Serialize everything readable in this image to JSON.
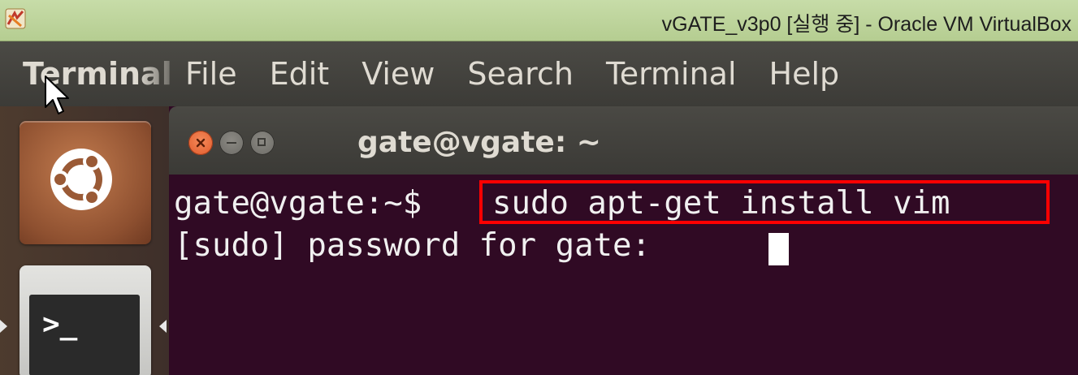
{
  "vbox": {
    "window_title": "vGATE_v3p0 [실행 중] - Oracle VM VirtualBox"
  },
  "menubar": {
    "app_name": "Terminal",
    "items": [
      "File",
      "Edit",
      "View",
      "Search",
      "Terminal",
      "Help"
    ]
  },
  "terminal": {
    "title": "gate@vgate: ~",
    "prompt": "gate@vgate:~$",
    "command": "sudo apt-get install vim",
    "password_prompt": "[sudo] password for gate: ",
    "background_color": "#300a24",
    "highlight_color": "#ff0000"
  },
  "launcher": {
    "icons": [
      "ubuntu-dash-icon",
      "terminal-app-icon"
    ]
  }
}
